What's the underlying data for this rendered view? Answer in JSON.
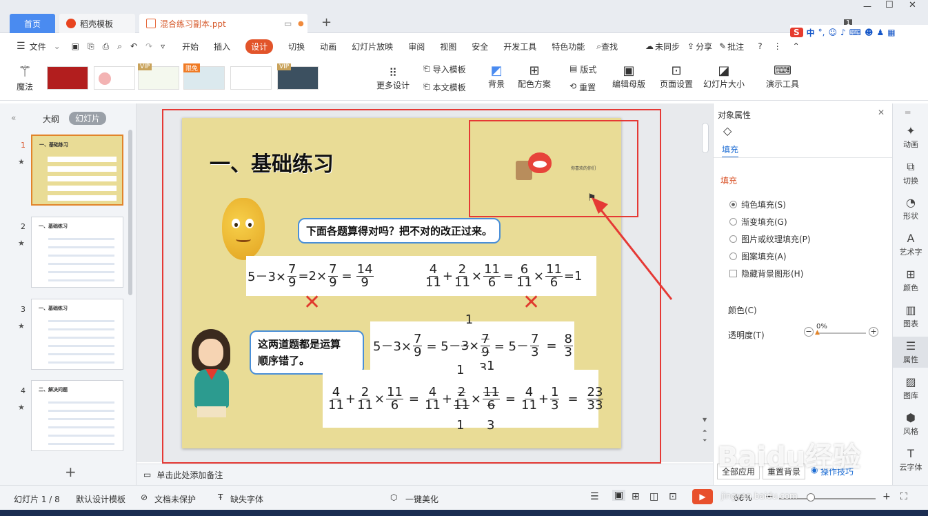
{
  "tabs": [
    {
      "label": "首页"
    },
    {
      "label": "稻壳模板"
    },
    {
      "label": "混合练习副本.ppt"
    }
  ],
  "tab_add": "+",
  "window": {
    "badge": "1"
  },
  "ime": {
    "logo": "S",
    "mode": "中"
  },
  "menu": {
    "file": "文件",
    "items": [
      "开始",
      "插入",
      "设计",
      "切换",
      "动画",
      "幻灯片放映",
      "审阅",
      "视图",
      "安全",
      "开发工具",
      "特色功能"
    ],
    "search": "查找",
    "sync": "未同步",
    "share": "分享",
    "comment": "批注"
  },
  "ribbon": {
    "magic": "魔法",
    "more_design": "更多设计",
    "import_tpl": "导入模板",
    "doc_tpl": "本文模板",
    "background": "背景",
    "color_scheme": "配色方案",
    "layout": "版式",
    "reset": "重置",
    "edit_master": "编辑母版",
    "page_setup": "页面设置",
    "slide_size": "幻灯片大小",
    "presenter": "演示工具",
    "vip1": "VIP",
    "limited": "限免",
    "vip2": "VIP"
  },
  "left": {
    "outline": "大纲",
    "slides": "幻灯片",
    "numbers": [
      "1",
      "2",
      "3",
      "4"
    ],
    "thumb_titles": [
      "一、基础练习",
      "一、基础练习",
      "一、基础练习",
      "二、解决问题"
    ],
    "add": "+"
  },
  "slide": {
    "title": "一、基础练习",
    "bubble1": "下面各题算得对吗？把不对的改正过来。",
    "bubble2a": "这两道题都是运算",
    "bubble2b": "顺序错了。",
    "logo_caption": "你喜欢的你们",
    "m": {
      "a": "5－3×",
      "n7": "7",
      "d9": "9",
      "eq2": "=2×",
      "eq": "=",
      "n14": "14",
      "n4": "4",
      "d11": "11",
      "plus": "+",
      "n2": "2",
      "times": "×",
      "n11": "11",
      "d6": "6",
      "n6": "6",
      "eq1": "=1",
      "c1": "5－3×",
      "c2": "= 5－",
      "n1": "1",
      "d3": "3",
      "c3": "= 5－",
      "n8": "8",
      "minus": "－",
      "n23": "23",
      "d33": "33"
    },
    "x": "✕"
  },
  "right": {
    "title": "对象属性",
    "tab_fill": "填充",
    "section_fill": "填充",
    "options": [
      "纯色填充(S)",
      "渐变填充(G)",
      "图片或纹理填充(P)",
      "图案填充(A)"
    ],
    "hide_bg": "隐藏背景图形(H)",
    "color": "颜色(C)",
    "transparency": "透明度(T)",
    "trans_value": "0%",
    "apply_all": "全部应用",
    "reset_bg": "重置背景",
    "tips": "操作技巧"
  },
  "rightbar": [
    "动画",
    "切换",
    "形状",
    "艺术字",
    "颜色",
    "图表",
    "属性",
    "图库",
    "风格",
    "云字体"
  ],
  "status": {
    "slide_info": "幻灯片 1 / 8",
    "design_tpl": "默认设计模板",
    "protect": "文档未保护",
    "missing_font": "缺失字体",
    "beautify": "一键美化",
    "zoom": "66%",
    "note": "单击此处添加备注"
  },
  "watermark": {
    "brand": "Baidu经验",
    "url": "jingyan.baidu.com"
  },
  "colors": {
    "accent": "#4a8bf0",
    "design": "#e2542a",
    "red": "#e53935",
    "slide_bg": "#e9dc96"
  }
}
